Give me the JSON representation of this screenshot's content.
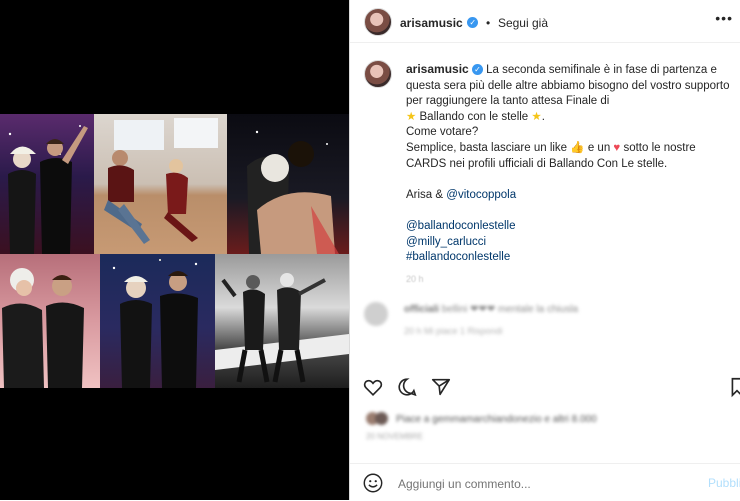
{
  "post": {
    "username": "arisamusic",
    "follow_label": "Segui già",
    "more_label": "•••"
  },
  "caption": {
    "username": "arisamusic",
    "lines": [
      "La seconda semifinale è in fase di partenza e",
      "questa sera più delle altre abbiamo bisogno del vostro supporto",
      "per raggiungere la tanto attesa Finale di"
    ],
    "show_line": "Ballando con le stelle",
    "line_vote": "Come votare?",
    "line_simple_a": "Semplice, basta lasciare un like",
    "line_simple_b": "e un",
    "line_simple_c": "sotto le nostre",
    "line_cards": "CARDS nei profili ufficiali di Ballando Con Le stelle.",
    "sign_prefix": "Arisa &",
    "sign_mention": "@vitocoppola",
    "mentions": [
      "@ballandoconlestelle",
      "@milly_carlucci",
      "#ballandoconlestelle"
    ],
    "time_faint": "20 h"
  },
  "comment": {
    "user_faint": "officiali",
    "text_faint": "bellini ❤❤❤ mentale la chiusla",
    "meta_faint": "20 h   Mi piace 1   Rispondi"
  },
  "likes": {
    "text_faint": "Piace a gemmamarchiandonezio e altri 8.000",
    "date_faint": "20 NOVEMBRE"
  },
  "add_comment": {
    "placeholder": "Aggiungi un commento...",
    "publish_label": "Pubblica"
  },
  "icons": {
    "like": "heart-outline-icon",
    "comment": "comment-bubble-icon",
    "share": "paper-plane-icon",
    "save": "bookmark-icon",
    "emoji": "smiley-icon"
  },
  "colors": {
    "link": "#00376b",
    "verified": "#3897f0",
    "heart": "#ed4956",
    "star": "#f5c518"
  }
}
